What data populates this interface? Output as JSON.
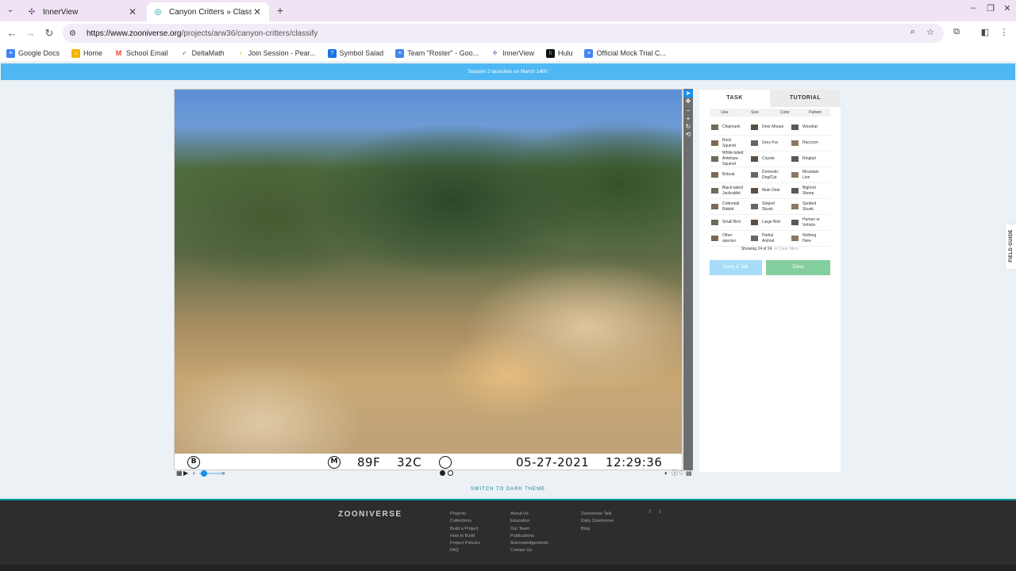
{
  "browser": {
    "tabs": [
      {
        "title": "InnerView",
        "icon": "innerview-icon",
        "active": false
      },
      {
        "title": "Canyon Critters » Classify — Zo",
        "icon": "zooniverse-icon",
        "active": true
      }
    ],
    "url_domain": "https://www.zooniverse.org",
    "url_path": "/projects/arw36/canyon-critters/classify",
    "bookmarks": [
      {
        "label": "Google Docs",
        "color": "#4285f4"
      },
      {
        "label": "Home",
        "color": "#f4b400"
      },
      {
        "label": "School Email",
        "color": "#ea4335"
      },
      {
        "label": "DeltaMath",
        "color": "#555555"
      },
      {
        "label": "Join Session - Pear...",
        "color": "#c8a400"
      },
      {
        "label": "Symbol Salad",
        "color": "#1a73e8"
      },
      {
        "label": "Team \"Roster\" - Goo...",
        "color": "#4285f4"
      },
      {
        "label": "InnerView",
        "color": "#7b3fa0"
      },
      {
        "label": "Hulu",
        "color": "#111111"
      },
      {
        "label": "Official Mock Trial C...",
        "color": "#4285f4"
      }
    ]
  },
  "page": {
    "banner": "Season 2 launches on March 14th!",
    "camera_stamp": {
      "left_badge": "B",
      "mid_badge": "M",
      "temp_f": "89F",
      "temp_c": "32C",
      "date": "05-27-2021",
      "time": "12:29:36"
    },
    "dark_theme": "SWITCH TO DARK THEME"
  },
  "task": {
    "tabs": [
      "TASK",
      "TUTORIAL"
    ],
    "filters": [
      "Like",
      "Size",
      "Color",
      "Pattern"
    ],
    "species": [
      [
        "Chipmunk"
      ],
      [
        "Deer Mouse"
      ],
      [
        "Woodrat"
      ],
      [
        "Rock",
        "Squirrel"
      ],
      [
        "Grey Fox"
      ],
      [
        "Raccoon"
      ],
      [
        "White-tailed",
        "Antelope",
        "Squirrel"
      ],
      [
        "Coyote"
      ],
      [
        "Ringtail"
      ],
      [
        "Bobcat"
      ],
      [
        "Domestic",
        "Dog/Cat"
      ],
      [
        "Mountain",
        "Lion"
      ],
      [
        "Black-tailed",
        "Jackrabbit"
      ],
      [
        "Mule Deer"
      ],
      [
        "Bighorn",
        "Sheep"
      ],
      [
        "Cottontail",
        "Rabbit"
      ],
      [
        "Striped",
        "Skunk"
      ],
      [
        "Spotted",
        "Skunk"
      ],
      [
        "Small Bird"
      ],
      [
        "Large Bird"
      ],
      [
        "Human or",
        "Vehicle"
      ],
      [
        "Other",
        "species"
      ],
      [
        "Partial",
        "Animal"
      ],
      [
        "Nothing",
        "Here"
      ]
    ],
    "showing": "Showing 24 of 24",
    "clear_filters": "Clear filters",
    "done_talk": "Done & Talk",
    "done": "Done",
    "field_guide": "FIELD GUIDE"
  },
  "footer": {
    "logo": "ZOONIVERSE",
    "col1": [
      "Projects",
      "Collections",
      "Build a Project",
      "How to Build",
      "Project Policies",
      "FAQ"
    ],
    "col2": [
      "About Us",
      "Education",
      "Our Team",
      "Publications",
      "Acknowledgements",
      "Contact Us"
    ],
    "col3": [
      "Zooniverse Talk",
      "Daily Zooniverse",
      "Blog"
    ],
    "social": [
      "f",
      "t"
    ]
  }
}
